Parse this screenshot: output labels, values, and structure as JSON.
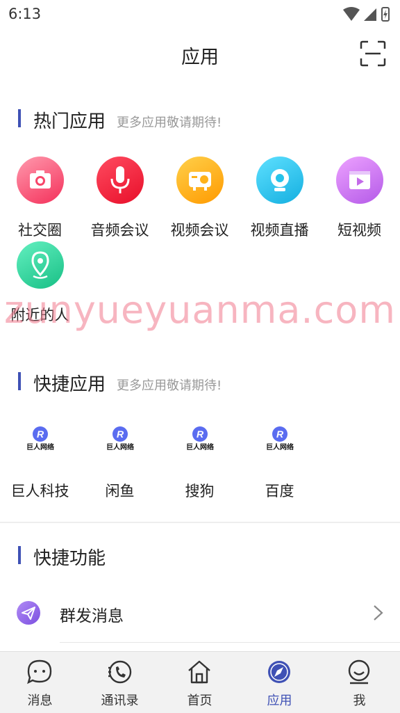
{
  "status_bar": {
    "time": "6:13",
    "icons": [
      "wifi-icon",
      "signal-icon",
      "battery-icon"
    ]
  },
  "header": {
    "title": "应用",
    "scan_icon": "scan-icon"
  },
  "hot_apps": {
    "title": "热门应用",
    "subtitle": "更多应用敬请期待!",
    "items": [
      {
        "label": "社交圈",
        "icon": "camera-icon",
        "color": "#f7466a"
      },
      {
        "label": "音频会议",
        "icon": "microphone-icon",
        "color": "#f0243b"
      },
      {
        "label": "视频会议",
        "icon": "projector-icon",
        "color": "#ffb21a"
      },
      {
        "label": "视频直播",
        "icon": "webcam-icon",
        "color": "#26c3ea"
      },
      {
        "label": "短视频",
        "icon": "video-icon",
        "color": "#d47ef0"
      },
      {
        "label": "附近的人",
        "icon": "location-pin-icon",
        "color": "#2ed79b"
      }
    ]
  },
  "watermark": "zunyueyuanma.com",
  "quick_apps": {
    "title": "快捷应用",
    "subtitle": "更多应用敬请期待!",
    "logo_text": "巨人网络",
    "items": [
      {
        "label": "巨人科技"
      },
      {
        "label": "闲鱼"
      },
      {
        "label": "搜狗"
      },
      {
        "label": "百度"
      }
    ]
  },
  "quick_features": {
    "title": "快捷功能",
    "items": [
      {
        "label": "群发消息",
        "icon": "paper-plane-icon"
      }
    ]
  },
  "tabbar": {
    "active": "应用",
    "active_color": "#3f51b5",
    "items": [
      {
        "label": "消息",
        "icon": "chat-bubble-icon"
      },
      {
        "label": "通讯录",
        "icon": "phone-book-icon"
      },
      {
        "label": "首页",
        "icon": "home-icon"
      },
      {
        "label": "应用",
        "icon": "compass-icon"
      },
      {
        "label": "我",
        "icon": "profile-icon"
      }
    ]
  }
}
